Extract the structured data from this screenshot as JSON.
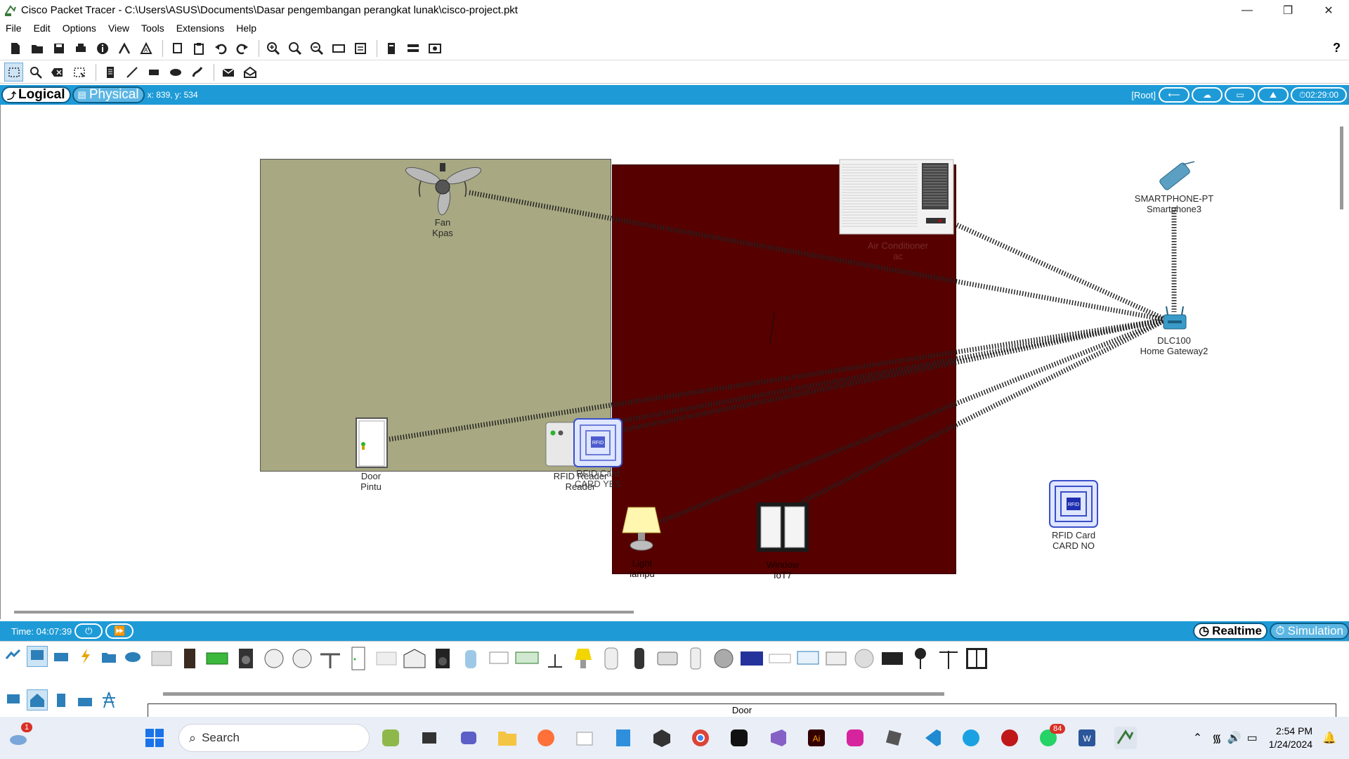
{
  "window": {
    "title": "Cisco Packet Tracer - C:\\Users\\ASUS\\Documents\\Dasar pengembangan perangkat lunak\\cisco-project.pkt",
    "minimize": "—",
    "restore": "❐",
    "close": "✕"
  },
  "menu": [
    "File",
    "Edit",
    "Options",
    "View",
    "Tools",
    "Extensions",
    "Help"
  ],
  "help_label": "?",
  "mode": {
    "logical_label": "Logical",
    "physical_label": "Physical",
    "coords": "x: 839, y: 534",
    "root_label": "[Root]",
    "clock": "02:29:00"
  },
  "devices": {
    "fan": {
      "type": "Fan",
      "name": "Kpas"
    },
    "air_conditioner": {
      "type": "Air Conditioner",
      "name": "ac"
    },
    "smartphone": {
      "type": "SMARTPHONE-PT",
      "name": "Smartphone3"
    },
    "gateway": {
      "type": "DLC100",
      "name": "Home Gateway2"
    },
    "door": {
      "type": "Door",
      "name": "Pintu"
    },
    "rfid_reader": {
      "type": "RFID Reader",
      "name": "Reader"
    },
    "rfid_card_yes": {
      "type": "RFID Card",
      "name": "CARD YES"
    },
    "light": {
      "type": "Light",
      "name": "lampu"
    },
    "window_dev": {
      "type": "Window",
      "name": "IoT7"
    },
    "rfid_card_no": {
      "type": "RFID Card",
      "name": "CARD NO"
    }
  },
  "status": {
    "time_label": "Time: 04:07:39",
    "realtime_label": "Realtime",
    "simulation_label": "Simulation"
  },
  "device_panel": {
    "selected_name": "Door"
  },
  "taskbar": {
    "search_placeholder": "Search",
    "time": "2:54 PM",
    "date": "1/24/2024",
    "weather_badge": "1",
    "whatsapp_badge": "84"
  },
  "colors": {
    "accent": "#1e9bd7",
    "room1": "#a8a882",
    "room2": "#560000"
  }
}
